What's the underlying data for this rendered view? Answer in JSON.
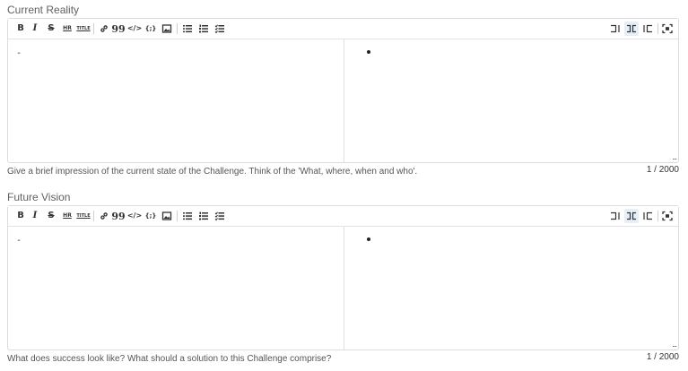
{
  "fields": [
    {
      "label": "Current Reality",
      "editor_text": "-",
      "help": "Give a brief impression of the current state of the Challenge. Think of the 'What, where, when and who'.",
      "counter": "1 / 2000"
    },
    {
      "label": "Future Vision",
      "editor_text": "-",
      "help": "What does success look like? What should a solution to this Challenge comprise?",
      "counter": "1 / 2000"
    }
  ],
  "toolbar": {
    "bold": "B",
    "italic": "I",
    "strike": "S",
    "hr": "HR",
    "title": "TITLE",
    "quote": "99",
    "code": "</>",
    "code_block": "{;}"
  },
  "resize_glyph": "...",
  "icons": [
    "bold-icon",
    "italic-icon",
    "strikethrough-icon",
    "horizontal-rule-icon",
    "title-icon",
    "link-icon",
    "quote-icon",
    "code-icon",
    "code-block-icon",
    "image-icon",
    "unordered-list-icon",
    "ordered-list-icon",
    "task-list-icon",
    "editor-only-icon",
    "live-preview-icon",
    "preview-only-icon",
    "fullscreen-icon"
  ],
  "colors": {
    "active_toggle_bg": "#e6eef9",
    "border": "#dcdcdc"
  }
}
